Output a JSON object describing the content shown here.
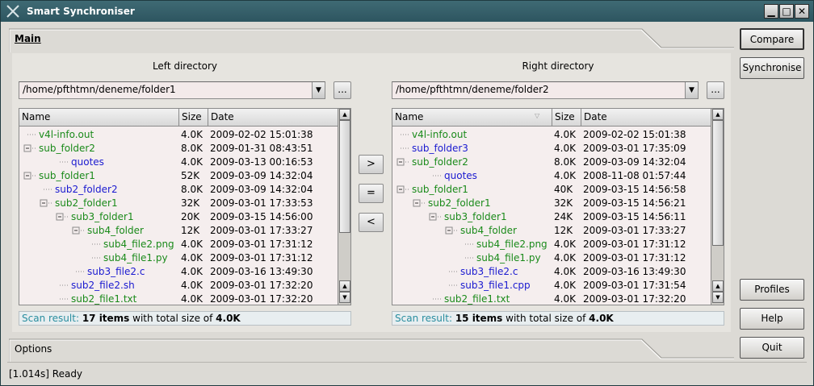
{
  "window": {
    "title": "Smart Synchroniser",
    "minimize": "▁",
    "maximize": "□",
    "close": "✕"
  },
  "tabs": {
    "main": "Main",
    "options": "Options"
  },
  "buttons": {
    "compare": "Compare",
    "synchronise": "Synchronise",
    "profiles": "Profiles",
    "help": "Help",
    "quit": "Quit",
    "copy_right": ">",
    "equal": "=",
    "copy_left": "<",
    "browse": "..."
  },
  "left": {
    "title": "Left directory",
    "path": "/home/pfthtmn/deneme/folder1",
    "columns": [
      "Name",
      "Size",
      "Date"
    ],
    "rows": [
      {
        "name": "v4l-info.out",
        "size": "4.0K",
        "date": "2009-02-02 15:01:38"
      },
      {
        "name": "sub_folder2",
        "size": "8.0K",
        "date": "2009-01-31 08:43:51"
      },
      {
        "name": "quotes",
        "size": "4.0K",
        "date": "2009-03-13 00:16:53"
      },
      {
        "name": "sub_folder1",
        "size": "52K",
        "date": "2009-03-09 14:32:04"
      },
      {
        "name": "sub2_folder2",
        "size": "8.0K",
        "date": "2009-03-09 14:32:04"
      },
      {
        "name": "sub2_folder1",
        "size": "32K",
        "date": "2009-03-01 17:33:53"
      },
      {
        "name": "sub3_folder1",
        "size": "20K",
        "date": "2009-03-15 14:56:00"
      },
      {
        "name": "sub4_folder",
        "size": "12K",
        "date": "2009-03-01 17:33:27"
      },
      {
        "name": "sub4_file2.png",
        "size": "4.0K",
        "date": "2009-03-01 17:31:12"
      },
      {
        "name": "sub4_file1.py",
        "size": "4.0K",
        "date": "2009-03-01 17:31:12"
      },
      {
        "name": "sub3_file2.c",
        "size": "4.0K",
        "date": "2009-03-16 13:49:30"
      },
      {
        "name": "sub2_file2.sh",
        "size": "4.0K",
        "date": "2009-03-01 17:32:20"
      },
      {
        "name": "sub2_file1.txt",
        "size": "4.0K",
        "date": "2009-03-01 17:32:20"
      }
    ],
    "scan_label": "Scan result:",
    "scan_items": "17 items",
    "scan_mid": "with total size of",
    "scan_size": "4.0K"
  },
  "right": {
    "title": "Right directory",
    "path": "/home/pfthtmn/deneme/folder2",
    "columns": [
      "Name",
      "Size",
      "Date"
    ],
    "rows": [
      {
        "name": "v4l-info.out",
        "size": "4.0K",
        "date": "2009-02-02 15:01:38"
      },
      {
        "name": "sub_folder3",
        "size": "4.0K",
        "date": "2009-03-01 17:35:09"
      },
      {
        "name": "sub_folder2",
        "size": "8.0K",
        "date": "2009-03-09 14:32:04"
      },
      {
        "name": "quotes",
        "size": "4.0K",
        "date": "2008-11-08 01:57:44"
      },
      {
        "name": "sub_folder1",
        "size": "40K",
        "date": "2009-03-15 14:56:58"
      },
      {
        "name": "sub2_folder1",
        "size": "32K",
        "date": "2009-03-15 14:56:21"
      },
      {
        "name": "sub3_folder1",
        "size": "24K",
        "date": "2009-03-15 14:56:11"
      },
      {
        "name": "sub4_folder",
        "size": "12K",
        "date": "2009-03-01 17:33:27"
      },
      {
        "name": "sub4_file2.png",
        "size": "4.0K",
        "date": "2009-03-01 17:31:12"
      },
      {
        "name": "sub4_file1.py",
        "size": "4.0K",
        "date": "2009-03-01 17:31:12"
      },
      {
        "name": "sub3_file2.c",
        "size": "4.0K",
        "date": "2009-03-16 13:49:30"
      },
      {
        "name": "sub3_file1.cpp",
        "size": "4.0K",
        "date": "2009-03-01 17:31:54"
      },
      {
        "name": "sub2_file1.txt",
        "size": "4.0K",
        "date": "2009-03-01 17:32:20"
      }
    ],
    "scan_label": "Scan result:",
    "scan_items": "15 items",
    "scan_mid": "with total size of",
    "scan_size": "4.0K"
  },
  "status": "[1.014s] Ready",
  "colors": {
    "equal_item": "#1a8a1a",
    "different_item": "#1a1ad0",
    "scan_label": "#2a8ea0"
  }
}
